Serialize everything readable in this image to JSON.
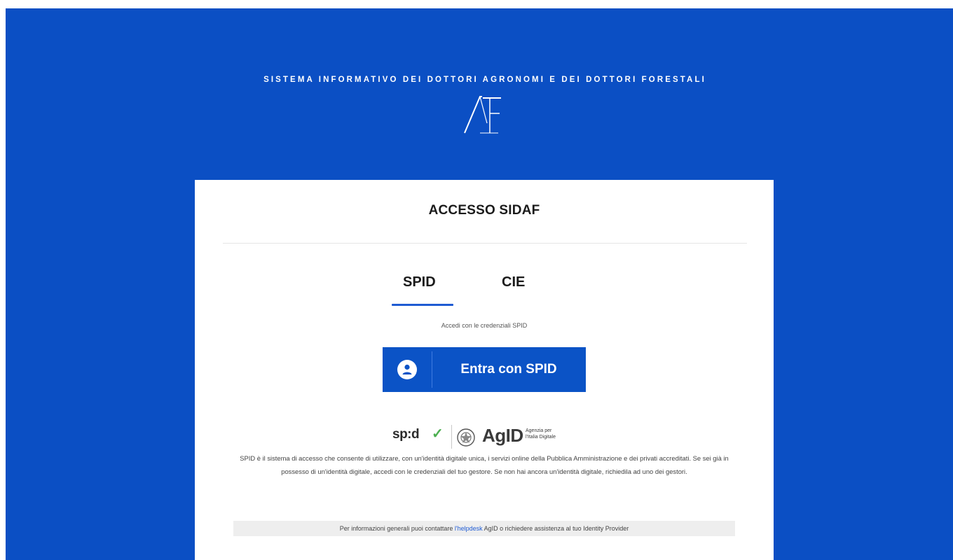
{
  "header": {
    "site_title": "SISTEMA INFORMATIVO DEI DOTTORI AGRONOMI E DEI DOTTORI FORESTALI",
    "logo_text": "AF"
  },
  "card": {
    "title": "ACCESSO SIDAF",
    "tabs": [
      {
        "label": "SPID",
        "active": true
      },
      {
        "label": "CIE",
        "active": false
      }
    ],
    "helper_text": "Accedi con le credenziali SPID",
    "spid_button_label": "Entra con SPID",
    "logos": {
      "spid": "sp:d",
      "agid": "AgID",
      "agid_subtitle_1": "Agenzia per",
      "agid_subtitle_2": "l'Italia Digitale"
    },
    "description": "SPID è il sistema di accesso che consente di utilizzare, con un'identità digitale unica, i servizi online della Pubblica Amministrazione e dei privati accreditati. Se sei già in possesso di un'identità digitale, accedi con le credenziali del tuo gestore. Se non hai ancora un'identità digitale, richiedila ad uno dei gestori.",
    "info_prefix": "Per informazioni generali puoi contattare ",
    "info_link": "l'helpdesk",
    "info_suffix": " AgID o richiedere assistenza al tuo Identity Provider"
  },
  "colors": {
    "background_blue": "#0b4fc4",
    "button_blue": "#0b53c6",
    "tab_accent": "#1f5bd3",
    "spid_check_green": "#4caf50"
  },
  "icons": [
    "af-logo-icon",
    "user-circle-icon",
    "check-icon",
    "agid-emblem-icon"
  ]
}
